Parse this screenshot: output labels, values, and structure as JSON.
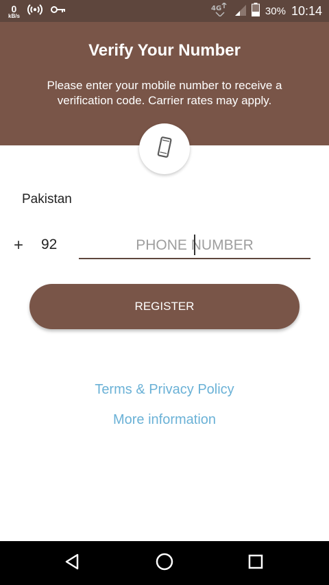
{
  "status_bar": {
    "speed_value": "0",
    "speed_unit": "kB/s",
    "battery_percent": "30%",
    "time": "10:14",
    "icons": [
      "hotspot-icon",
      "vpn-key-icon",
      "network-4g-icon",
      "signal-icon",
      "battery-icon"
    ]
  },
  "header": {
    "title": "Verify Your Number",
    "subtitle": "Please enter your mobile number to receive a verification code. Carrier rates may apply.",
    "icon": "phone-icon"
  },
  "form": {
    "country": "Pakistan",
    "plus": "+",
    "country_code": "92",
    "phone_value": "",
    "phone_placeholder": "PHONE NUMBER",
    "register_label": "REGISTER"
  },
  "links": {
    "terms": "Terms & Privacy Policy",
    "more_info": "More information"
  },
  "colors": {
    "header_bg": "#795548",
    "status_bg": "#5e463d",
    "link": "#6ab1d6"
  },
  "nav": {
    "icons": [
      "back-icon",
      "home-icon",
      "recents-icon"
    ]
  }
}
